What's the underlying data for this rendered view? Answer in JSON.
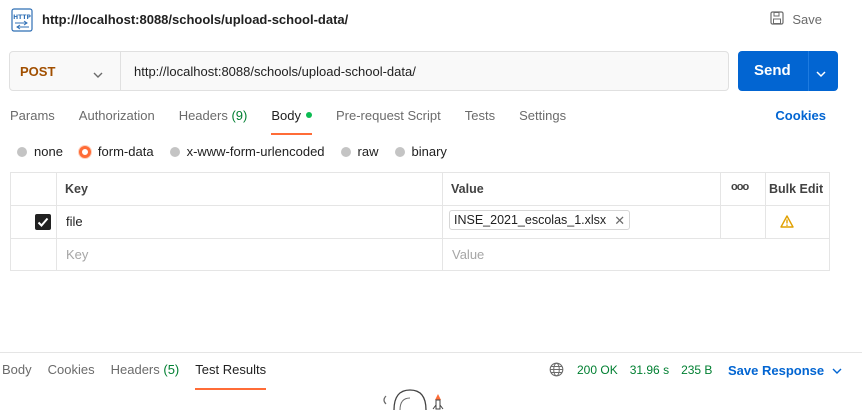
{
  "header": {
    "title": "http://localhost:8088/schools/upload-school-data/",
    "save_label": "Save",
    "app_icon": "http-request-icon"
  },
  "request": {
    "method": "POST",
    "url": "http://localhost:8088/schools/upload-school-data/",
    "send_label": "Send"
  },
  "tabs": {
    "params": "Params",
    "authorization": "Authorization",
    "headers": "Headers",
    "headers_count": "(9)",
    "body": "Body",
    "pre_request": "Pre-request Script",
    "tests": "Tests",
    "settings": "Settings",
    "cookies": "Cookies"
  },
  "body_types": {
    "none": "none",
    "form_data": "form-data",
    "urlencoded": "x-www-form-urlencoded",
    "raw": "raw",
    "binary": "binary",
    "selected": "form-data"
  },
  "table": {
    "key_header": "Key",
    "value_header": "Value",
    "more": "ooo",
    "bulk_edit": "Bulk Edit",
    "rows": [
      {
        "key": "file",
        "value": "INSE_2021_escolas_1.xlsx",
        "checked": true
      }
    ],
    "key_placeholder": "Key",
    "value_placeholder": "Value"
  },
  "response": {
    "tabs": {
      "body": "Body",
      "cookies": "Cookies",
      "headers": "Headers",
      "headers_count": "(5)",
      "test_results": "Test Results"
    },
    "status": "200 OK",
    "time": "31.96 s",
    "size": "235 B",
    "save_response": "Save Response"
  },
  "colors": {
    "accent": "#ff6c37",
    "primary": "#0265d2",
    "method": "#a14f00",
    "success": "#007f31",
    "warning": "#ffb400"
  }
}
